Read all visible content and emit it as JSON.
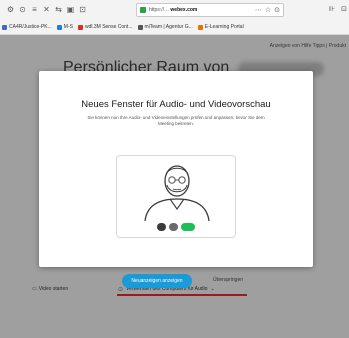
{
  "browser": {
    "nav_icons": [
      "⚙",
      "⊙",
      "≡",
      "✕",
      "⇆",
      "▣",
      "⊡"
    ],
    "url_host": "webex.com",
    "url_path": "https://…",
    "url_actions": [
      "⋯",
      "☆",
      "⊙"
    ],
    "right_icons": [
      "⊪",
      "⊡"
    ]
  },
  "bookmarks": [
    {
      "label": "CA4R/Justice-PK...",
      "color": "#3d6fb8"
    },
    {
      "label": "M-S",
      "color": "#2a7bd1"
    },
    {
      "label": "wdl.3M Sense Cont...",
      "color": "#d93025"
    },
    {
      "label": "miTeam | Agentur G...",
      "color": "#555555"
    },
    {
      "label": "E-Learning Portal",
      "color": "#e8710a"
    }
  ],
  "page": {
    "top_links": "Anzeigen von Hilfe Tipps  |  Produkt",
    "room_title": "Persönlicher Raum von"
  },
  "modal": {
    "title": "Neues Fenster für Audio- und Videovorschau",
    "body": "Sie können nun Ihre Audio- und Videoeinstellungen prüfen und anpassen, bevor Sie dem Meeting beitreten.",
    "primary_button": "Neuanzeigen anzeigen",
    "skip_button": "Überspringen"
  },
  "bottom_bar": {
    "left_label": "Video starten",
    "center_label": "Verwenden des Computers für Audio",
    "center_chevron": "⌄"
  },
  "colors": {
    "accent": "#1a9bd7",
    "video_on": "#1bbf55",
    "underline": "#e0161b"
  }
}
